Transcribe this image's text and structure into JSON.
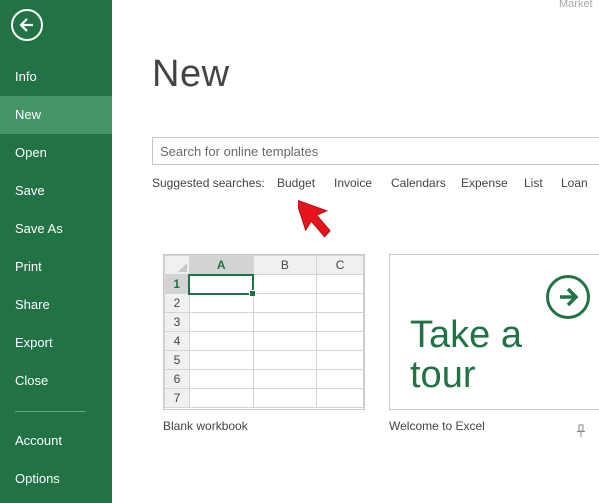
{
  "window": {
    "corner_text": "Market"
  },
  "sidebar": {
    "back_icon": "back-arrow-circle-icon",
    "items": [
      {
        "label": "Info",
        "active": false
      },
      {
        "label": "New",
        "active": true
      },
      {
        "label": "Open",
        "active": false
      },
      {
        "label": "Save",
        "active": false
      },
      {
        "label": "Save As",
        "active": false
      },
      {
        "label": "Print",
        "active": false
      },
      {
        "label": "Share",
        "active": false
      },
      {
        "label": "Export",
        "active": false
      },
      {
        "label": "Close",
        "active": false
      }
    ],
    "bottom_items": [
      {
        "label": "Account"
      },
      {
        "label": "Options"
      }
    ]
  },
  "main": {
    "title": "New",
    "search": {
      "placeholder": "Search for online templates",
      "value": ""
    },
    "suggested": {
      "label": "Suggested searches:",
      "links": [
        "Budget",
        "Invoice",
        "Calendars",
        "Expense",
        "List",
        "Loan"
      ]
    },
    "templates": [
      {
        "caption": "Blank workbook",
        "columns": [
          "A",
          "B",
          "C"
        ],
        "rows": [
          "1",
          "2",
          "3",
          "4",
          "5",
          "6",
          "7"
        ]
      },
      {
        "caption": "Welcome to Excel",
        "tour_text": "Take a\ntour",
        "icon": "arrow-right-circle-icon",
        "pin_icon": "pin-icon"
      }
    ]
  },
  "colors": {
    "excel_green": "#217346",
    "sidebar_active": "#439467",
    "annotation_red": "#e8141b"
  }
}
